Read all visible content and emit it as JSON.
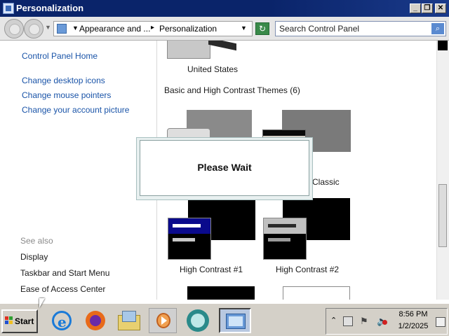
{
  "window": {
    "title": "Personalization",
    "controls": {
      "minimize": "_",
      "restore": "❐",
      "close": "✕"
    }
  },
  "address_bar": {
    "breadcrumb_1": "Appearance and ...",
    "separator": "▸",
    "breadcrumb_2": "Personalization",
    "search_placeholder": "Search Control Panel"
  },
  "left_pane": {
    "home_link": "Control Panel Home",
    "links": [
      "Change desktop icons",
      "Change mouse pointers",
      "Change your account picture"
    ],
    "see_also_heading": "See also",
    "see_also": [
      "Display",
      "Taskbar and Start Menu",
      "Ease of Access Center"
    ]
  },
  "themes": {
    "top_theme_label": "United States",
    "section_heading": "Basic and High Contrast Themes (6)",
    "items": [
      {
        "label": "",
        "id": "windows-basic"
      },
      {
        "label": "Classic",
        "id": "classic"
      },
      {
        "label": "High Contrast #1",
        "id": "hc1"
      },
      {
        "label": "High Contrast #2",
        "id": "hc2"
      }
    ]
  },
  "dialog": {
    "message": "Please Wait"
  },
  "taskbar": {
    "start_label": "Start",
    "apps": [
      "internet-explorer-icon",
      "firefox-icon",
      "file-explorer-icon",
      "media-player-icon",
      "vlc-like-icon",
      "control-panel-icon"
    ],
    "clock_time": "8:56 PM",
    "clock_date": "1/2/2025"
  },
  "colors": {
    "title_bar": "#0a246a",
    "link": "#1a54a8",
    "hc1_accent": "#0a0a8c",
    "hc2_accent": "#c0c0c0"
  }
}
